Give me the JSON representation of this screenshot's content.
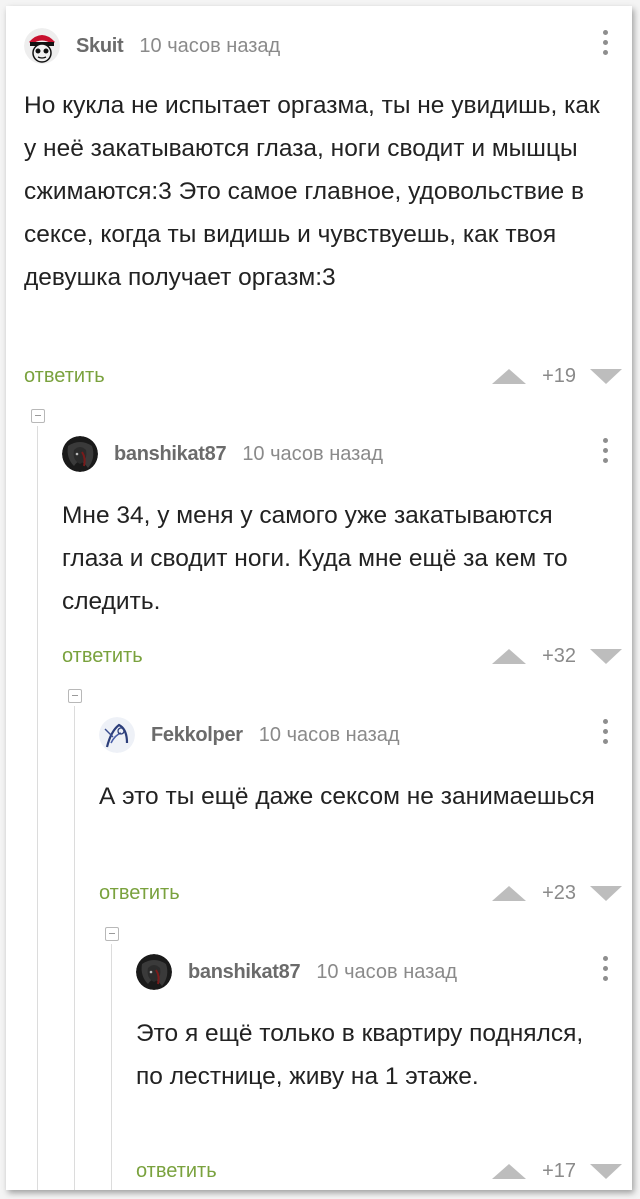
{
  "comments": [
    {
      "author": "Skuit",
      "time": "10 часов назад",
      "text": "Но кукла не испытает оргазма, ты не увидишь, как у неё закатываются глаза, ноги сводит и мышцы сжимаются:3 Это самое главное, удовольствие в сексе, когда ты видишь и чувствуешь, как твоя девушка получает оргазм:3",
      "reply_label": "ответить",
      "score": "+19",
      "avatar_icon": "cartoon-avatar-icon"
    },
    {
      "author": "banshikat87",
      "time": "10 часов назад",
      "text": "Мне 34, у меня у самого уже закатываются глаза и сводит ноги. Куда мне ещё за кем то следить.",
      "reply_label": "ответить",
      "score": "+32",
      "avatar_icon": "dark-portrait-avatar-icon"
    },
    {
      "author": "Fekkolper",
      "time": "10 часов назад",
      "text": "А это ты ещё даже сексом не занимаешься",
      "reply_label": "ответить",
      "score": "+23",
      "avatar_icon": "sketch-avatar-icon"
    },
    {
      "author": "banshikat87",
      "time": "10 часов назад",
      "text": "Это я ещё только в квартиру поднялся, по лестнице, живу на 1 этаже.",
      "reply_label": "ответить",
      "score": "+17",
      "avatar_icon": "dark-portrait-avatar-icon"
    }
  ],
  "colors": {
    "reply_link": "#7aa23e",
    "meta_text": "#8a8a8a",
    "body_text": "#222222",
    "vote_arrow": "#bdbdbd"
  }
}
